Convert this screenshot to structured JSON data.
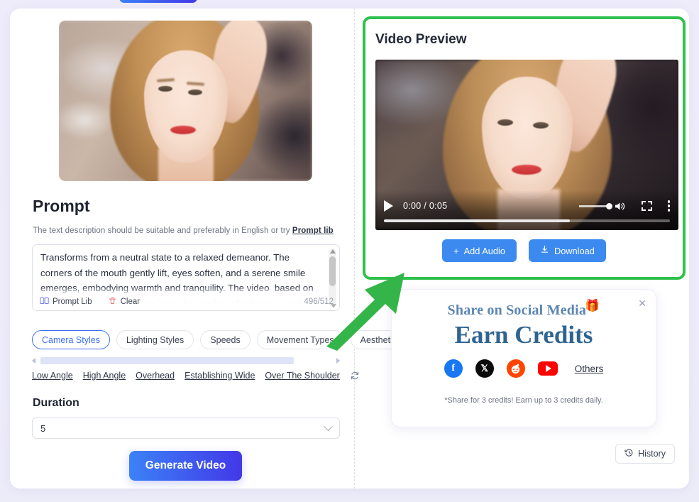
{
  "app": {
    "background_color": "#eeecfb",
    "accent_blue": "#3b82f6",
    "highlight_green": "#2fc14c"
  },
  "left_panel": {
    "uploaded_image_alt": "uploaded-portrait-thumbnail",
    "prompt": {
      "title": "Prompt",
      "helper_text": "The text description should be suitable and preferably in English or try ",
      "helper_link": "Prompt lib",
      "textarea_value": "Transforms from a neutral state to a relaxed demeanor. The corners of the mouth gently lift, eyes soften, and a serene smile emerges, embodying warmth and tranquility. The video  based on the uploaded image, determining the number of subjects, gender, ensuring all subjects display identical expression changes. The",
      "prompt_lib_label": "Prompt Lib",
      "clear_label": "Clear",
      "counter": "496/512"
    },
    "style_tabs": [
      {
        "label": "Camera Styles",
        "active": true
      },
      {
        "label": "Lighting Styles",
        "active": false
      },
      {
        "label": "Speeds",
        "active": false
      },
      {
        "label": "Movement Types",
        "active": false
      },
      {
        "label": "Aesthetic",
        "active": false
      }
    ],
    "style_options": [
      "Low Angle",
      "High Angle",
      "Overhead",
      "Establishing Wide",
      "Over The Shoulder"
    ],
    "refresh_icon": "refresh-icon",
    "duration": {
      "label": "Duration",
      "value": "5"
    },
    "generate_button": "Generate Video"
  },
  "right_panel": {
    "preview": {
      "title": "Video Preview",
      "player": {
        "current_time": "0:00",
        "total_time": "0:05",
        "time_display": "0:00 / 0:05",
        "play_icon": "play-icon",
        "volume_icon": "volume-icon",
        "fullscreen_icon": "fullscreen-icon",
        "more_icon": "more-options-icon",
        "progress_percent": 65
      },
      "actions": [
        {
          "label": "Add Audio",
          "icon": "plus-icon"
        },
        {
          "label": "Download",
          "icon": "download-icon"
        }
      ]
    },
    "share_card": {
      "line1": "Share on Social Media",
      "gift_icon": "🎁",
      "line2": "Earn Credits",
      "socials": [
        {
          "name": "facebook",
          "glyph": "f"
        },
        {
          "name": "x-twitter",
          "glyph": "✕"
        },
        {
          "name": "reddit",
          "glyph": "👽"
        },
        {
          "name": "youtube",
          "glyph": "▶"
        }
      ],
      "others_label": "Others",
      "note": "*Share for 3 credits! Earn up to 3 credits daily.",
      "close_icon": "✕"
    },
    "history_button": "History"
  }
}
